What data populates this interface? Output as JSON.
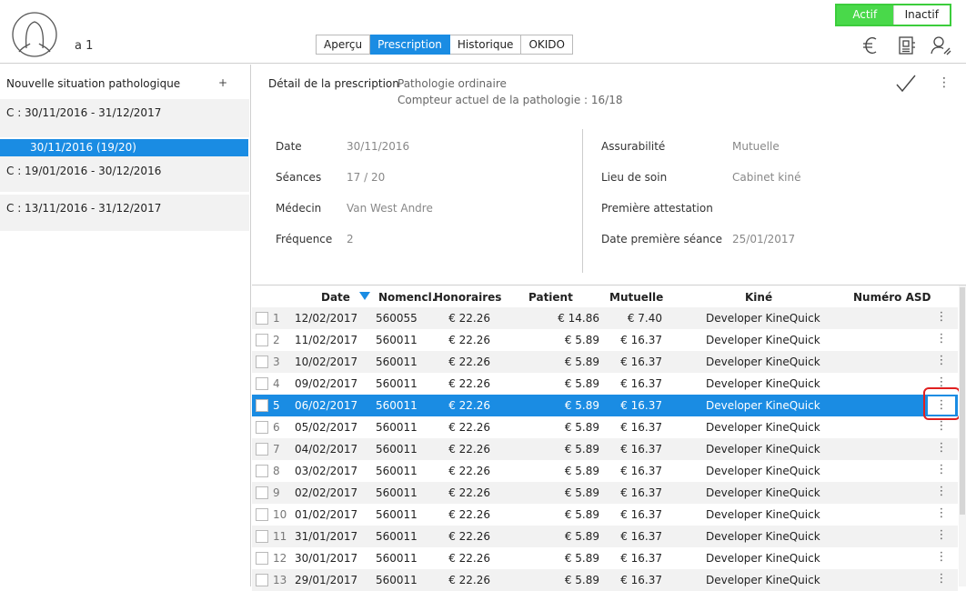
{
  "header": {
    "patient_name": "a 1",
    "tabs": [
      "Aperçu",
      "Prescription",
      "Historique",
      "OKIDO"
    ],
    "active_tab": "Prescription",
    "status_on": "Actif",
    "status_off": "Inactif",
    "icons": [
      "euro-icon",
      "barcode-doc-icon",
      "user-edit-icon"
    ]
  },
  "sidebar": {
    "new_label": "Nouvelle situation pathologique",
    "add_label": "+",
    "items": [
      "C : 30/11/2016 - 31/12/2017",
      "C : 19/01/2016 - 30/12/2016",
      "C : 13/11/2016 - 31/12/2017"
    ],
    "selected_sub": "30/11/2016  (19/20)"
  },
  "detail": {
    "title": "Détail de la prescription",
    "pathology": "Pathologie ordinaire",
    "counter": "Compteur actuel de la pathologie : 16/18",
    "left_fields": [
      {
        "label": "Date",
        "value": "30/11/2016"
      },
      {
        "label": "Séances",
        "value": "17 / 20"
      },
      {
        "label": "Médecin",
        "value": "Van West Andre"
      },
      {
        "label": "Fréquence",
        "value": "2"
      }
    ],
    "right_fields": [
      {
        "label": "Assurabilité",
        "value": "Mutuelle"
      },
      {
        "label": "Lieu de soin",
        "value": "Cabinet kiné"
      },
      {
        "label": "Première attestation",
        "value": ""
      },
      {
        "label": "Date première séance",
        "value": "25/01/2017"
      }
    ]
  },
  "table": {
    "headers": [
      "Date",
      "Nomencl.",
      "Honoraires",
      "Patient",
      "Mutuelle",
      "Kiné",
      "Numéro ASD"
    ],
    "menu_glyph": "⋮",
    "rows": [
      {
        "n": "1",
        "date": "12/02/2017",
        "nom": "560055",
        "hon": "€ 22.26",
        "pat": "€ 14.86",
        "mut": "€ 7.40",
        "kine": "Developer KineQuick"
      },
      {
        "n": "2",
        "date": "11/02/2017",
        "nom": "560011",
        "hon": "€ 22.26",
        "pat": "€ 5.89",
        "mut": "€ 16.37",
        "kine": "Developer KineQuick"
      },
      {
        "n": "3",
        "date": "10/02/2017",
        "nom": "560011",
        "hon": "€ 22.26",
        "pat": "€ 5.89",
        "mut": "€ 16.37",
        "kine": "Developer KineQuick"
      },
      {
        "n": "4",
        "date": "09/02/2017",
        "nom": "560011",
        "hon": "€ 22.26",
        "pat": "€ 5.89",
        "mut": "€ 16.37",
        "kine": "Developer KineQuick"
      },
      {
        "n": "5",
        "date": "06/02/2017",
        "nom": "560011",
        "hon": "€ 22.26",
        "pat": "€ 5.89",
        "mut": "€ 16.37",
        "kine": "Developer KineQuick",
        "selected": true
      },
      {
        "n": "6",
        "date": "05/02/2017",
        "nom": "560011",
        "hon": "€ 22.26",
        "pat": "€ 5.89",
        "mut": "€ 16.37",
        "kine": "Developer KineQuick"
      },
      {
        "n": "7",
        "date": "04/02/2017",
        "nom": "560011",
        "hon": "€ 22.26",
        "pat": "€ 5.89",
        "mut": "€ 16.37",
        "kine": "Developer KineQuick"
      },
      {
        "n": "8",
        "date": "03/02/2017",
        "nom": "560011",
        "hon": "€ 22.26",
        "pat": "€ 5.89",
        "mut": "€ 16.37",
        "kine": "Developer KineQuick"
      },
      {
        "n": "9",
        "date": "02/02/2017",
        "nom": "560011",
        "hon": "€ 22.26",
        "pat": "€ 5.89",
        "mut": "€ 16.37",
        "kine": "Developer KineQuick"
      },
      {
        "n": "10",
        "date": "01/02/2017",
        "nom": "560011",
        "hon": "€ 22.26",
        "pat": "€ 5.89",
        "mut": "€ 16.37",
        "kine": "Developer KineQuick"
      },
      {
        "n": "11",
        "date": "31/01/2017",
        "nom": "560011",
        "hon": "€ 22.26",
        "pat": "€ 5.89",
        "mut": "€ 16.37",
        "kine": "Developer KineQuick"
      },
      {
        "n": "12",
        "date": "30/01/2017",
        "nom": "560011",
        "hon": "€ 22.26",
        "pat": "€ 5.89",
        "mut": "€ 16.37",
        "kine": "Developer KineQuick"
      },
      {
        "n": "13",
        "date": "29/01/2017",
        "nom": "560011",
        "hon": "€ 22.26",
        "pat": "€ 5.89",
        "mut": "€ 16.37",
        "kine": "Developer KineQuick"
      }
    ]
  },
  "colors": {
    "accent": "#1a8ce3",
    "active_green": "#49d94a",
    "highlight_red": "#e02020"
  }
}
